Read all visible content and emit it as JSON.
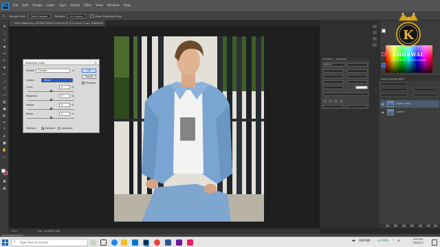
{
  "app": {
    "logo_text": "Ps"
  },
  "menu": [
    "File",
    "Edit",
    "Image",
    "Layer",
    "Type",
    "Select",
    "Filter",
    "View",
    "Window",
    "Help"
  ],
  "options_bar": {
    "sample_size_label": "Sample Size:",
    "sample_size_value": "Point Sample",
    "sample_label": "Sample:",
    "sample_value": "All Layers",
    "show_ring_label": "Show Sampling Ring"
  },
  "document_tab": {
    "title": "...2020_RBtpeyimg_DSt789579054251026.jpg @ 21% (Layer 0 copy, RGB/8#) *",
    "close": "×"
  },
  "dialog": {
    "title": "Selective Color",
    "close": "×",
    "preset_label": "Preset:",
    "preset_value": "Custom",
    "colors_label": "Colors:",
    "colors_value": "Blue",
    "sliders": [
      {
        "label": "Cyan:",
        "value": "0",
        "unit": "%",
        "level": 0.5
      },
      {
        "label": "Magenta:",
        "value": "0",
        "unit": "%",
        "level": 0.5
      },
      {
        "label": "Yellow:",
        "value": "0",
        "unit": "%",
        "level": 0.5
      },
      {
        "label": "Black:",
        "value": "0",
        "unit": "%",
        "level": 0.5
      }
    ],
    "method_label": "Method:",
    "method_relative": "Relative",
    "method_absolute": "Absolute",
    "ok": "OK",
    "cancel": "Cancel",
    "preview": "Preview"
  },
  "character_panel": {
    "tab1": "Character",
    "tab2": "Paragraph",
    "font": "DIN Pro"
  },
  "brand": {
    "name": "KHORWAL",
    "sub": "GRAPHIC DESIGNER",
    "monogram": "K"
  },
  "layers_panel": {
    "tabs": "Layers   Channels   Paths",
    "layers": [
      {
        "name": "Layer 0 copy",
        "selected": true
      },
      {
        "name": "Layer 0",
        "selected": false
      }
    ]
  },
  "status": {
    "zoom": "21%",
    "doc": "Doc: 19.9M/35.6M"
  },
  "mini_bridge": "Mini Bridge   Timeline",
  "taskbar": {
    "search_placeholder": "Type here to search",
    "currency_pair": "GBP/INR",
    "currency_change": "+0.14%",
    "time": "9:00 PM",
    "date": "7/8/2021"
  },
  "colors": {
    "accent_blue": "#1e5fd8",
    "ps_blue": "#31a8ff",
    "ui_dark": "#282828",
    "panel": "#424242"
  }
}
